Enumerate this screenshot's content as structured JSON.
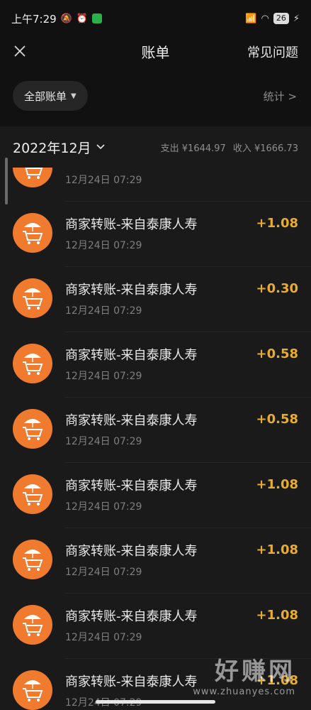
{
  "status_bar": {
    "time": "上午7:29",
    "battery": "26",
    "wechat_color": "#2bb14a"
  },
  "header": {
    "title": "账单",
    "faq_label": "常见问题",
    "close_icon": "close-icon"
  },
  "filter": {
    "all_bills_label": "全部账单",
    "stats_label": "统计 >"
  },
  "month_bar": {
    "month": "2022年12月",
    "expense": "支出 ¥1644.97",
    "income": "收入 ¥1666.73"
  },
  "colors": {
    "accent_amount": "#e7ac33",
    "avatar_bg": "#f07a2e"
  },
  "transactions": [
    {
      "title": "",
      "date": "12月24日 07:29",
      "amount": ""
    },
    {
      "title": "商家转账-来自泰康人寿",
      "date": "12月24日 07:29",
      "amount": "+1.08"
    },
    {
      "title": "商家转账-来自泰康人寿",
      "date": "12月24日 07:29",
      "amount": "+0.30"
    },
    {
      "title": "商家转账-来自泰康人寿",
      "date": "12月24日 07:29",
      "amount": "+0.58"
    },
    {
      "title": "商家转账-来自泰康人寿",
      "date": "12月24日 07:29",
      "amount": "+0.58"
    },
    {
      "title": "商家转账-来自泰康人寿",
      "date": "12月24日 07:29",
      "amount": "+1.08"
    },
    {
      "title": "商家转账-来自泰康人寿",
      "date": "12月24日 07:29",
      "amount": "+1.08"
    },
    {
      "title": "商家转账-来自泰康人寿",
      "date": "12月24日 07:29",
      "amount": "+1.08"
    },
    {
      "title": "商家转账-来自泰康人寿",
      "date": "12月24日 07:29",
      "amount": "+1.08"
    }
  ],
  "watermark": {
    "big": "好赚网",
    "small": "www.zhuanyes.com"
  }
}
